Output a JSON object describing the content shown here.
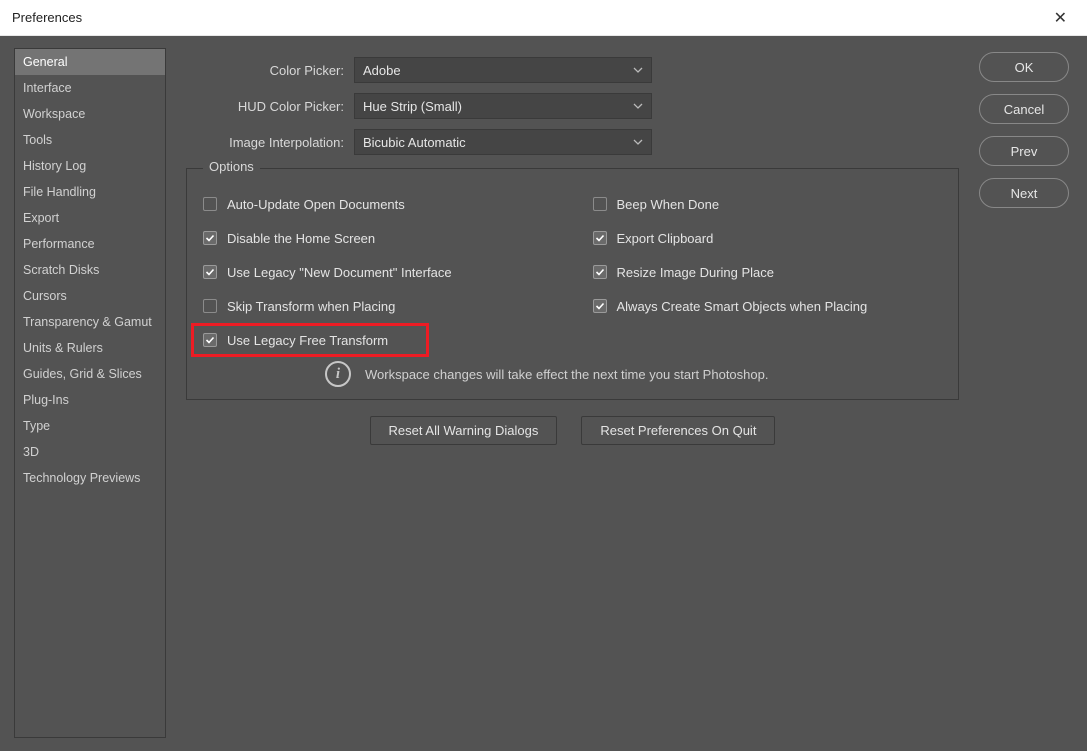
{
  "title": "Preferences",
  "sidebar": {
    "items": [
      {
        "label": "General",
        "selected": true
      },
      {
        "label": "Interface"
      },
      {
        "label": "Workspace"
      },
      {
        "label": "Tools"
      },
      {
        "label": "History Log"
      },
      {
        "label": "File Handling"
      },
      {
        "label": "Export"
      },
      {
        "label": "Performance"
      },
      {
        "label": "Scratch Disks"
      },
      {
        "label": "Cursors"
      },
      {
        "label": "Transparency & Gamut"
      },
      {
        "label": "Units & Rulers"
      },
      {
        "label": "Guides, Grid & Slices"
      },
      {
        "label": "Plug-Ins"
      },
      {
        "label": "Type"
      },
      {
        "label": "3D"
      },
      {
        "label": "Technology Previews"
      }
    ]
  },
  "form": {
    "color_picker": {
      "label": "Color Picker:",
      "value": "Adobe"
    },
    "hud_color_picker": {
      "label": "HUD Color Picker:",
      "value": "Hue Strip (Small)"
    },
    "image_interpolation": {
      "label": "Image Interpolation:",
      "value": "Bicubic Automatic"
    }
  },
  "options": {
    "legend": "Options",
    "left": [
      {
        "label": "Auto-Update Open Documents",
        "checked": false,
        "highlight": false
      },
      {
        "label": "Disable the Home Screen",
        "checked": true,
        "highlight": false
      },
      {
        "label": "Use Legacy \"New Document\" Interface",
        "checked": true,
        "highlight": false
      },
      {
        "label": "Skip Transform when Placing",
        "checked": false,
        "highlight": false
      },
      {
        "label": "Use Legacy Free Transform",
        "checked": true,
        "highlight": true
      }
    ],
    "right": [
      {
        "label": "Beep When Done",
        "checked": false
      },
      {
        "label": "Export Clipboard",
        "checked": true
      },
      {
        "label": "Resize Image During Place",
        "checked": true
      },
      {
        "label": "Always Create Smart Objects when Placing",
        "checked": true
      }
    ],
    "info": "Workspace changes will take effect the next time you start Photoshop."
  },
  "buttons": {
    "reset_warnings": "Reset All Warning Dialogs",
    "reset_prefs": "Reset Preferences On Quit",
    "ok": "OK",
    "cancel": "Cancel",
    "prev": "Prev",
    "next": "Next"
  }
}
